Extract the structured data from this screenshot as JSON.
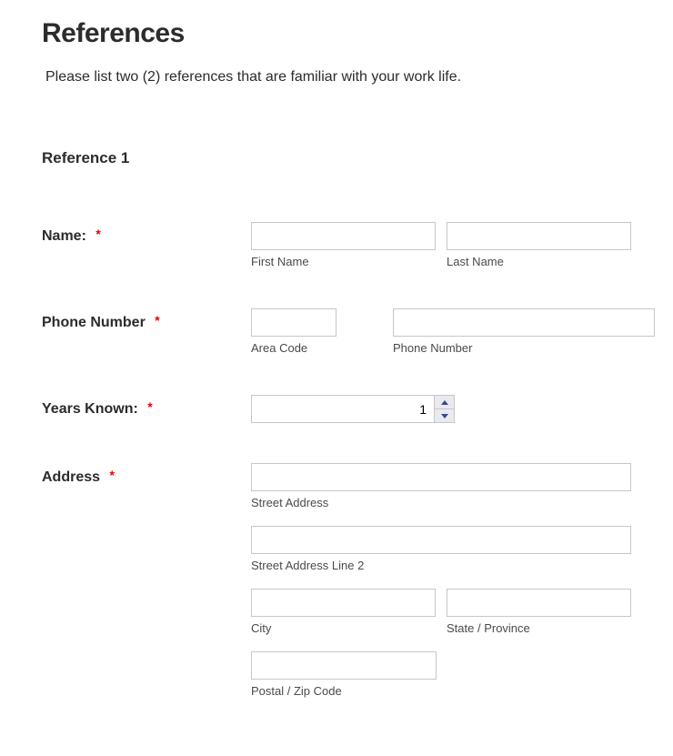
{
  "heading": "References",
  "intro": "Please list two (2) references that are familiar with your work life.",
  "section": "Reference 1",
  "name": {
    "label": "Name:",
    "first_sub": "First Name",
    "last_sub": "Last Name",
    "first_value": "",
    "last_value": ""
  },
  "phone": {
    "label": "Phone Number",
    "area_sub": "Area Code",
    "number_sub": "Phone Number",
    "area_value": "",
    "number_value": ""
  },
  "years": {
    "label": "Years Known:",
    "value": "1"
  },
  "address": {
    "label": "Address",
    "street1_sub": "Street Address",
    "street2_sub": "Street Address Line 2",
    "city_sub": "City",
    "state_sub": "State / Province",
    "postal_sub": "Postal / Zip Code",
    "street1_value": "",
    "street2_value": "",
    "city_value": "",
    "state_value": "",
    "postal_value": ""
  },
  "required_mark": "*"
}
